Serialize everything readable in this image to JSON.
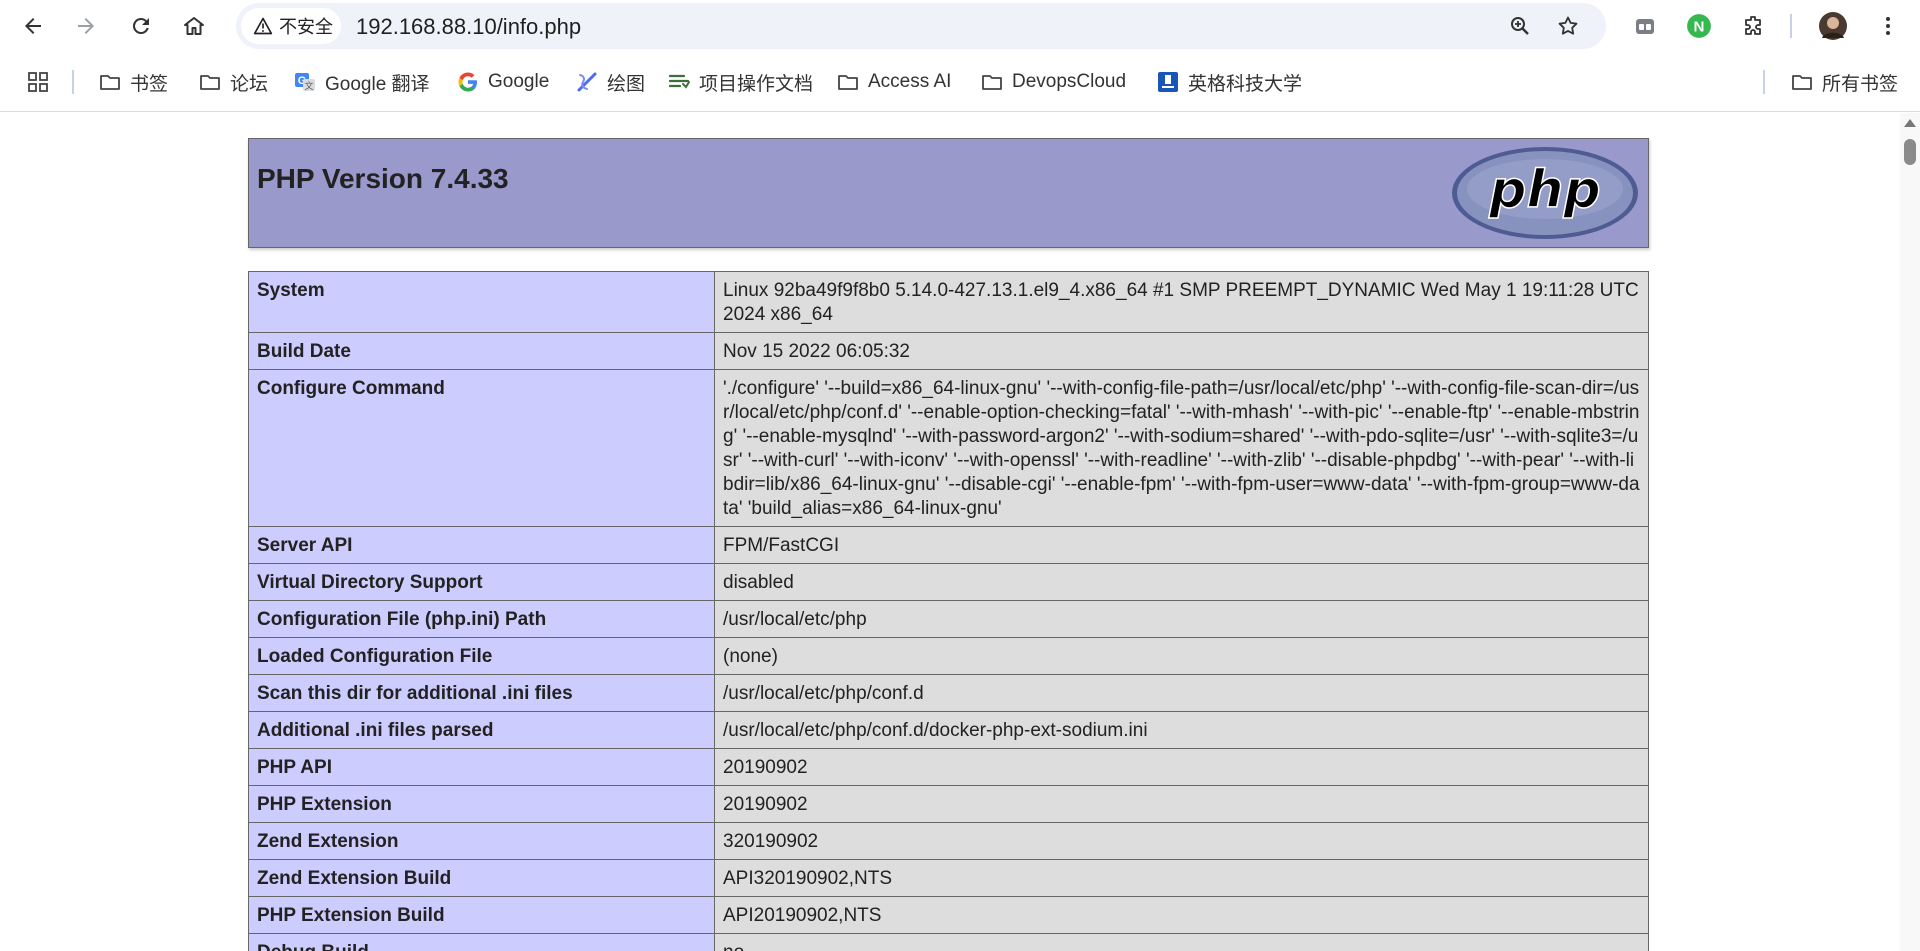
{
  "browser": {
    "security_label": "不安全",
    "url": "192.168.88.10/info.php",
    "ext_badge": "N"
  },
  "bookmarks": [
    {
      "label": "书签",
      "icon": "folder-icon"
    },
    {
      "label": "论坛",
      "icon": "folder-icon"
    },
    {
      "label": "Google 翻译",
      "icon": "google-translate-icon"
    },
    {
      "label": "Google",
      "icon": "google-icon"
    },
    {
      "label": "绘图",
      "icon": "draw-icon"
    },
    {
      "label": "项目操作文档",
      "icon": "doc-icon"
    },
    {
      "label": "Access AI",
      "icon": "folder-icon"
    },
    {
      "label": "DevopsCloud",
      "icon": "folder-icon"
    },
    {
      "label": "英格科技大学",
      "icon": "site-icon"
    }
  ],
  "all_bookmarks_label": "所有书签",
  "page": {
    "title": "PHP Version 7.4.33",
    "logo_text": "php",
    "rows": [
      {
        "key": "System",
        "value": "Linux 92ba49f9f8b0 5.14.0-427.13.1.el9_4.x86_64 #1 SMP PREEMPT_DYNAMIC Wed May 1 19:11:28 UTC 2024 x86_64"
      },
      {
        "key": "Build Date",
        "value": "Nov 15 2022 06:05:32"
      },
      {
        "key": "Configure Command",
        "value": "'./configure' '--build=x86_64-linux-gnu' '--with-config-file-path=/usr/local/etc/php' '--with-config-file-scan-dir=/usr/local/etc/php/conf.d' '--enable-option-checking=fatal' '--with-mhash' '--with-pic' '--enable-ftp' '--enable-mbstring' '--enable-mysqlnd' '--with-password-argon2' '--with-sodium=shared' '--with-pdo-sqlite=/usr' '--with-sqlite3=/usr' '--with-curl' '--with-iconv' '--with-openssl' '--with-readline' '--with-zlib' '--disable-phpdbg' '--with-pear' '--with-libdir=lib/x86_64-linux-gnu' '--disable-cgi' '--enable-fpm' '--with-fpm-user=www-data' '--with-fpm-group=www-data' 'build_alias=x86_64-linux-gnu'"
      },
      {
        "key": "Server API",
        "value": "FPM/FastCGI"
      },
      {
        "key": "Virtual Directory Support",
        "value": "disabled"
      },
      {
        "key": "Configuration File (php.ini) Path",
        "value": "/usr/local/etc/php"
      },
      {
        "key": "Loaded Configuration File",
        "value": "(none)"
      },
      {
        "key": "Scan this dir for additional .ini files",
        "value": "/usr/local/etc/php/conf.d"
      },
      {
        "key": "Additional .ini files parsed",
        "value": "/usr/local/etc/php/conf.d/docker-php-ext-sodium.ini"
      },
      {
        "key": "PHP API",
        "value": "20190902"
      },
      {
        "key": "PHP Extension",
        "value": "20190902"
      },
      {
        "key": "Zend Extension",
        "value": "320190902"
      },
      {
        "key": "Zend Extension Build",
        "value": "API320190902,NTS"
      },
      {
        "key": "PHP Extension Build",
        "value": "API20190902,NTS"
      },
      {
        "key": "Debug Build",
        "value": "no"
      }
    ]
  }
}
